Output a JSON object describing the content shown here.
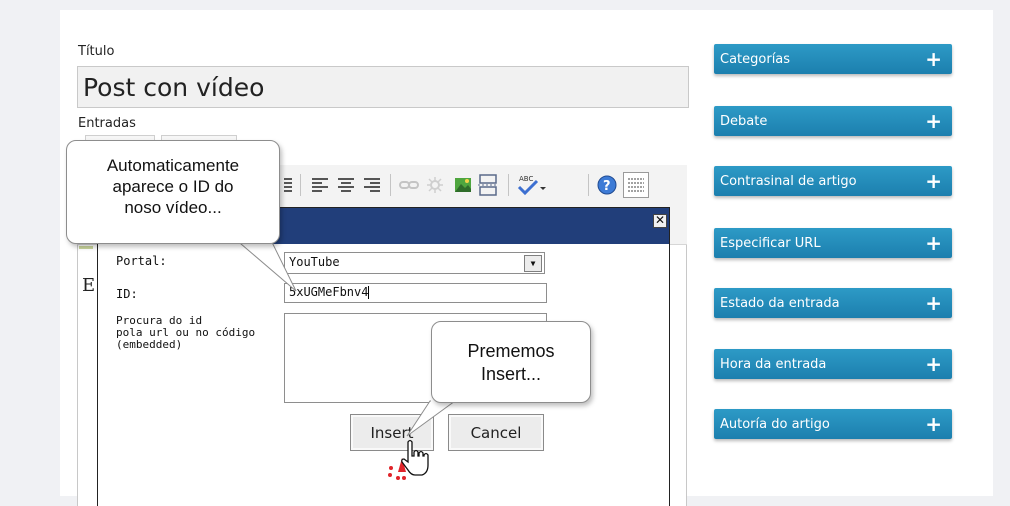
{
  "post": {
    "title_label": "Título",
    "title_value": "Post con vídeo",
    "entries_label": "Entradas"
  },
  "editor": {
    "partial_text": "E"
  },
  "dialog": {
    "close_symbol": "✕",
    "portal_label": "Portal:",
    "portal_value": "YouTube",
    "id_label": "ID:",
    "id_value": "5xUGMeFbnv4",
    "search_label": "Procura do id\npola url ou no código\n(embedded)",
    "insert_label": "Insert",
    "cancel_label": "Cancel"
  },
  "callouts": {
    "id_hint": "Automaticamente\naparece o ID do\nnoso vídeo...",
    "insert_hint": "Prememos\nInsert..."
  },
  "sidebar": {
    "items": [
      {
        "label": "Categorías"
      },
      {
        "label": "Debate"
      },
      {
        "label": "Contrasinal de artigo"
      },
      {
        "label": "Especificar URL"
      },
      {
        "label": "Estado da entrada"
      },
      {
        "label": "Hora da entrada"
      },
      {
        "label": "Autoría do artigo"
      }
    ],
    "plus_symbol": "+"
  },
  "icons": [
    "align-left-icon",
    "align-center-icon",
    "align-right-icon",
    "link-icon",
    "unlink-icon",
    "image-icon",
    "more-icon",
    "spellcheck-icon",
    "help-icon",
    "kitchen-sink-icon",
    "close-icon",
    "chevron-down-icon",
    "hand-cursor-icon",
    "plus-icon"
  ],
  "colors": {
    "sidebar_accent": "#2389b9",
    "dialog_titlebar": "#213e7a",
    "click_marker": "#e0242a"
  }
}
